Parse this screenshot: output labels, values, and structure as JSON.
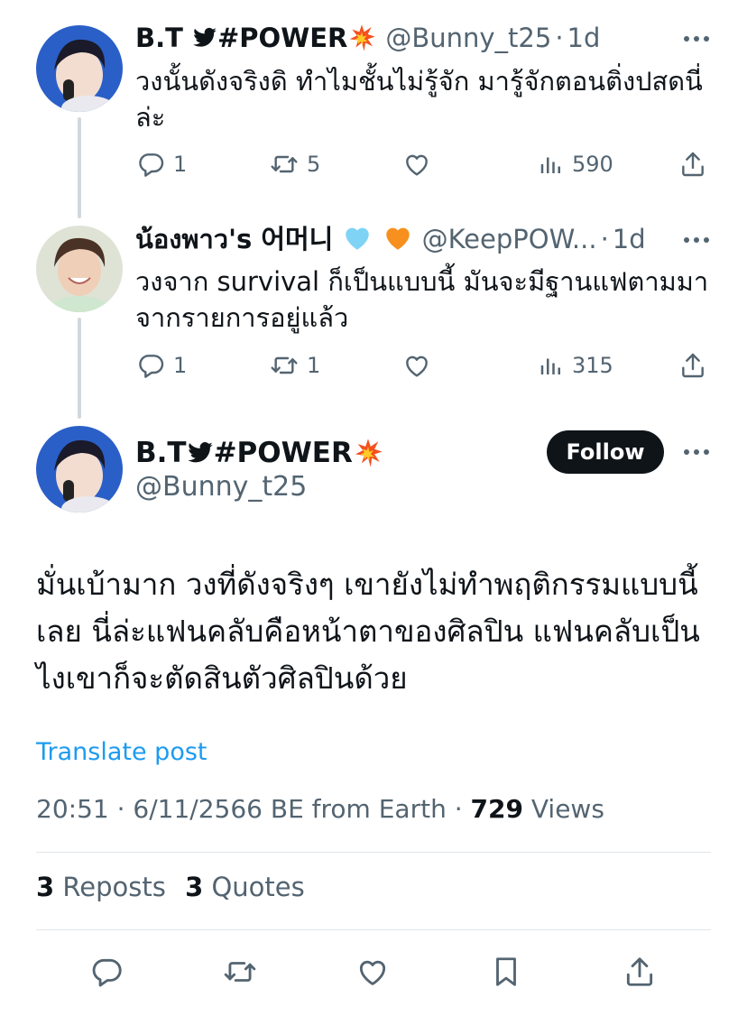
{
  "thread": [
    {
      "name": "B.T ",
      "name_suffix": "#POWER",
      "handle": "@Bunny_t25",
      "time": "1d",
      "text": "วงนั้นดังจริงดิ ทำไมชั้นไม่รู้จัก มารู้จักตอนติ่งปสดนี่ล่ะ",
      "replies": "1",
      "reposts": "5",
      "views": "590"
    },
    {
      "name": "น้องพาว's 어머니",
      "handle": "@KeepPOW...",
      "time": "1d",
      "text": "วงจาก survival ก็เป็นแบบนี้ มันจะมีฐานแฟตามมาจากรายการอยู่แล้ว",
      "replies": "1",
      "reposts": "1",
      "views": "315"
    }
  ],
  "main": {
    "name": "B.T ",
    "name_suffix": "#POWER",
    "handle": "@Bunny_t25",
    "follow_label": "Follow",
    "text": "มั่นเบ้ามาก วงที่ดังจริงๆ เขายังไม่ทำพฤติกรรมแบบนี้เลย นี่ล่ะแฟนคลับคือหน้าตาของศิลปิน แฟนคลับเป็นไงเขาก็จะตัดสินตัวศิลปินด้วย",
    "translate_label": "Translate post",
    "timestamp": "20:51 · 6/11/2566 BE from Earth · ",
    "views_count": "729",
    "views_label": " Views",
    "reposts_count": "3",
    "reposts_label": " Reposts",
    "quotes_count": "3",
    "quotes_label": " Quotes"
  },
  "icons": {
    "reply": "reply-icon",
    "repost": "repost-icon",
    "like": "heart-icon",
    "views": "views-icon",
    "share": "share-icon",
    "bookmark": "bookmark-icon",
    "verified_bird": "bird-icon",
    "collision": "collision-emoji-icon",
    "hearts": [
      "light-blue-heart-icon",
      "orange-heart-icon"
    ]
  },
  "colors": {
    "text": "#0f1419",
    "secondary": "#536471",
    "link": "#1d9bf0",
    "follow_bg": "#0f1419",
    "bird": "#0f1419"
  }
}
